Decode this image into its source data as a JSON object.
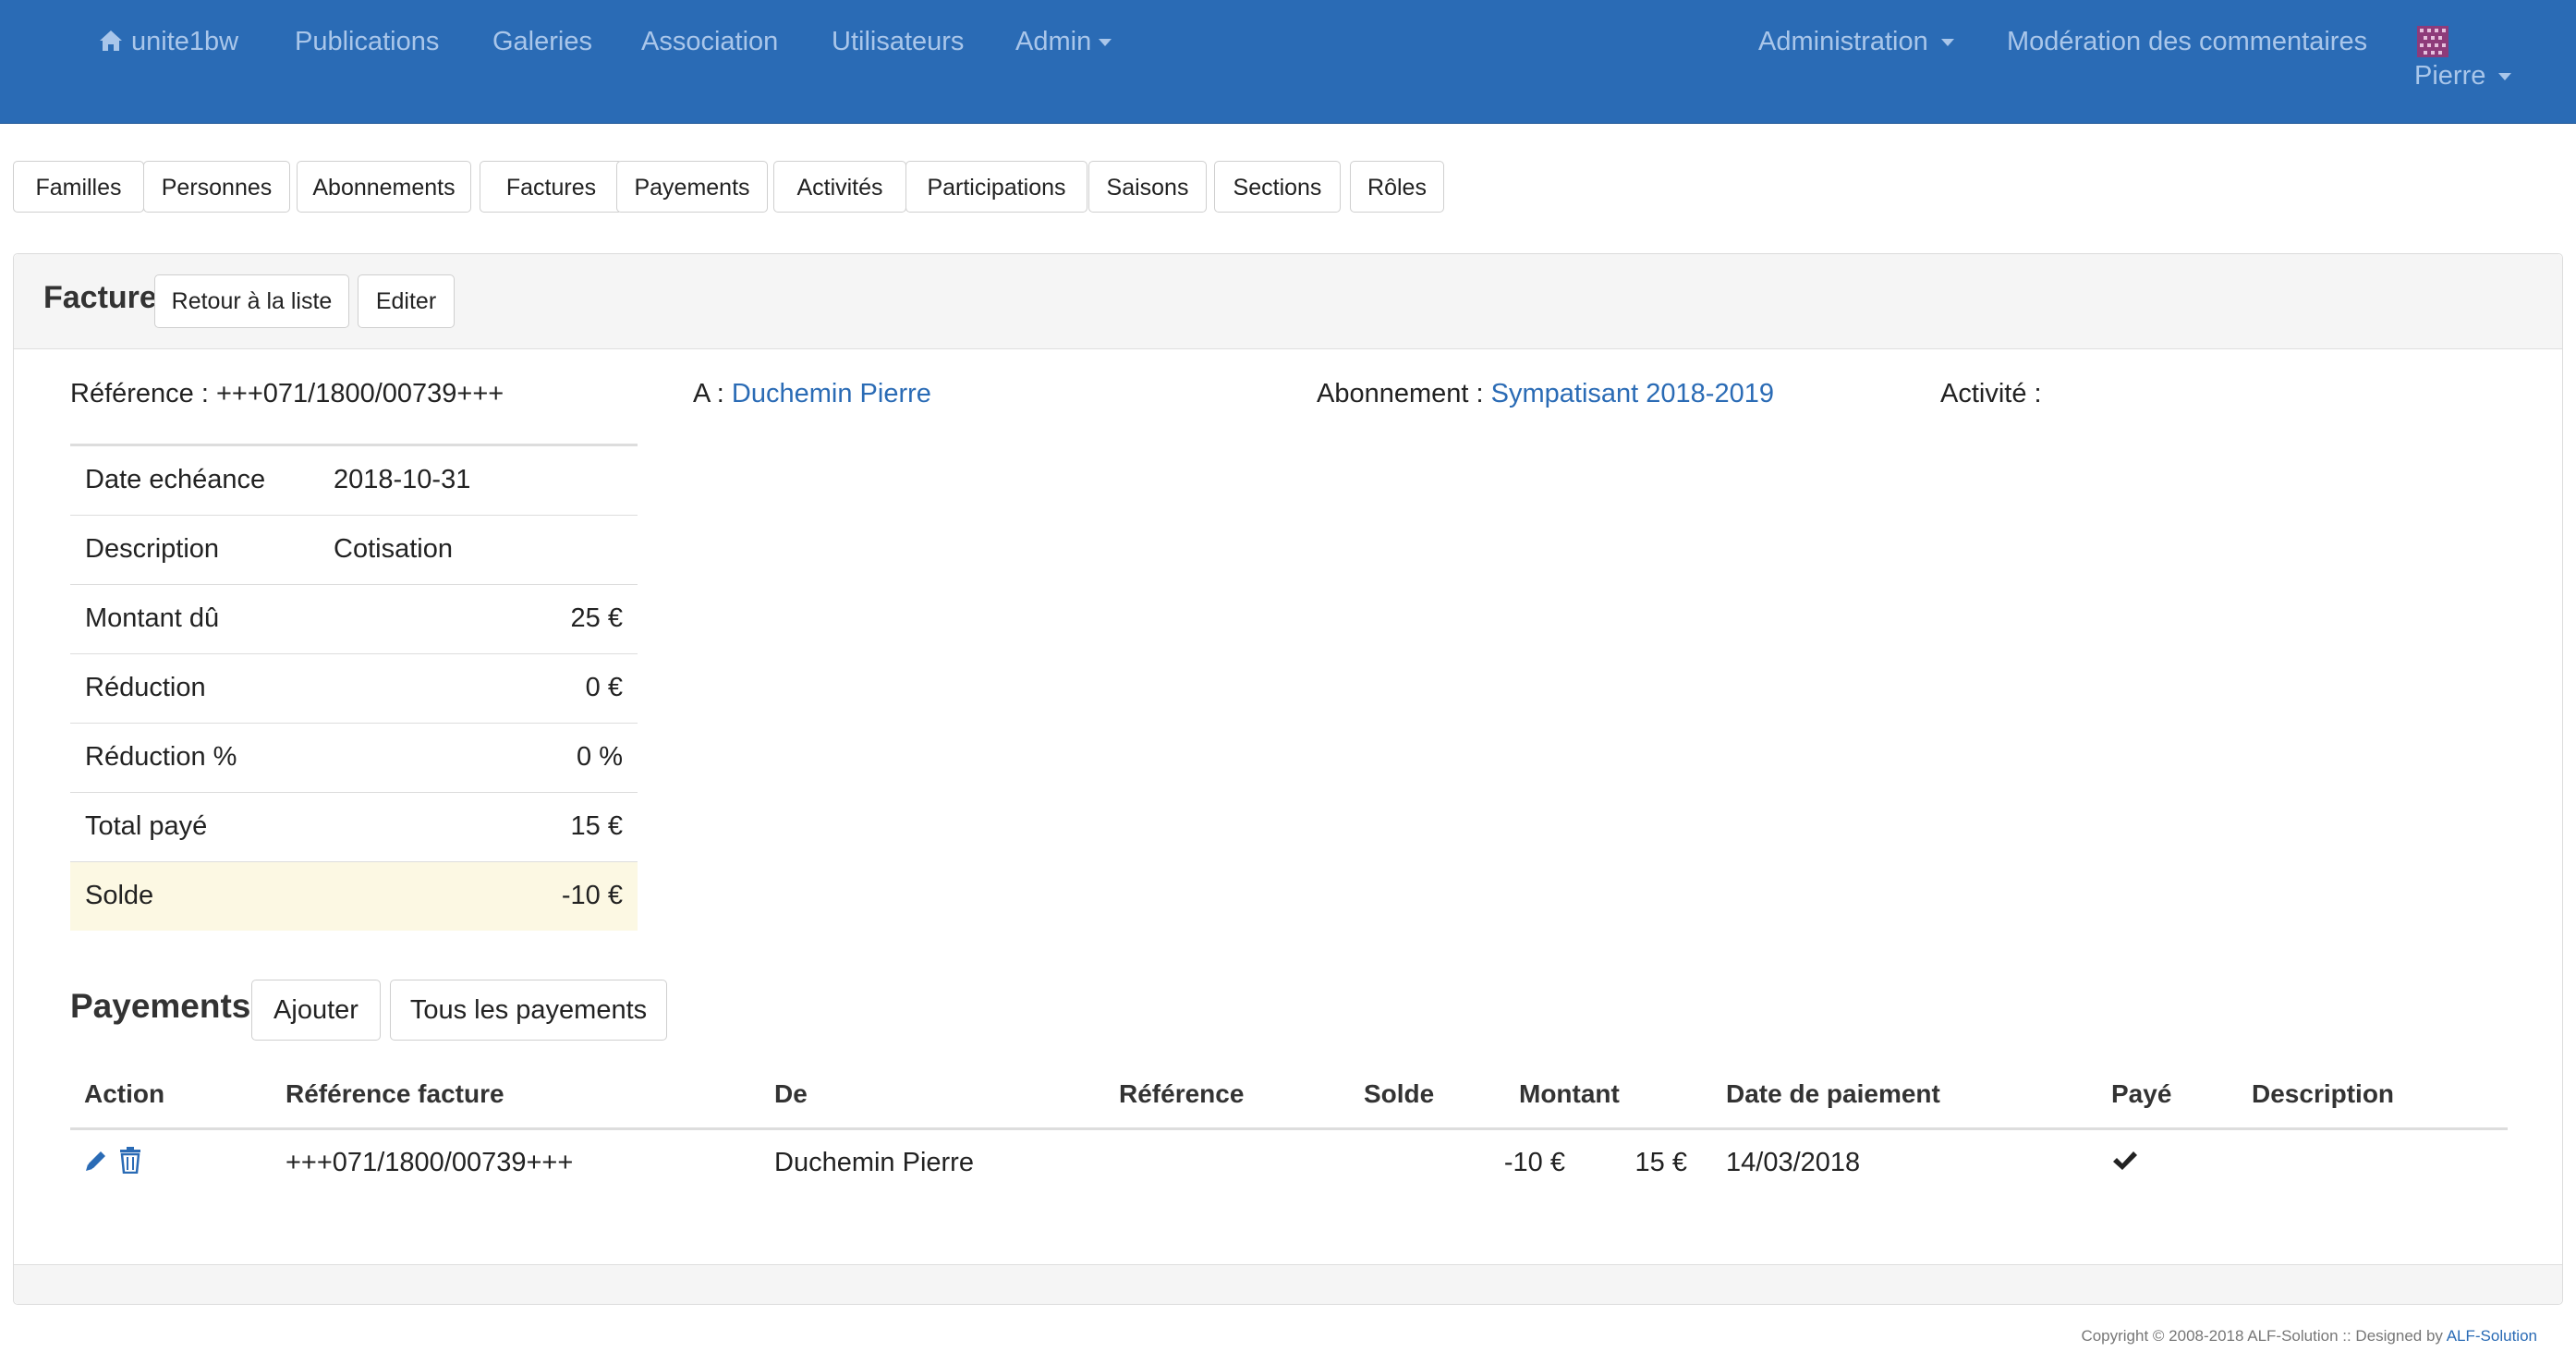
{
  "navbar": {
    "brand": "unite1bw",
    "items": [
      "Publications",
      "Galeries",
      "Association",
      "Utilisateurs",
      "Admin"
    ],
    "right_items": [
      "Administration",
      "Modération des commentaires"
    ],
    "user": "Pierre",
    "icons": [
      "home-icon",
      "avatar-icon",
      "caret-down-icon"
    ]
  },
  "tabs": [
    "Familles",
    "Personnes",
    "Abonnements",
    "Factures",
    "Payements",
    "Activités",
    "Participations",
    "Saisons",
    "Sections",
    "Rôles"
  ],
  "panel": {
    "title": "Facture",
    "back_button": "Retour à la liste",
    "edit_button": "Editer"
  },
  "summary": {
    "reference_label": "Référence : +++071/1800/00739+++",
    "to_label": "A :",
    "to_value": "Duchemin Pierre",
    "subscription_label": "Abonnement :",
    "subscription_value": "Sympatisant 2018-2019",
    "activity_label": "Activité :"
  },
  "details": [
    {
      "label": "Date echéance",
      "value": "2018-10-31"
    },
    {
      "label": "Description",
      "value": "Cotisation"
    },
    {
      "label": "Montant dû",
      "value": "25 €"
    },
    {
      "label": "Réduction",
      "value": "0 €"
    },
    {
      "label": "Réduction %",
      "value": "0 %"
    },
    {
      "label": "Total payé",
      "value": "15 €"
    },
    {
      "label": "Solde",
      "value": "-10 €"
    }
  ],
  "payments": {
    "title": "Payements",
    "add_button": "Ajouter",
    "all_button": "Tous les payements",
    "columns": [
      "Action",
      "Référence facture",
      "De",
      "Référence",
      "Solde",
      "Montant",
      "Date de paiement",
      "Payé",
      "Description"
    ],
    "rows": [
      {
        "reference_facture": "+++071/1800/00739+++",
        "de": "Duchemin Pierre",
        "reference": "",
        "solde": "-10 €",
        "montant": "15 €",
        "date": "14/03/2018",
        "paye_icon": "check-icon",
        "description": "",
        "action_icons": [
          "edit-icon",
          "trash-icon"
        ]
      }
    ]
  },
  "footer": {
    "text": "Copyright © 2008-2018 ALF-Solution :: Designed by ",
    "link": "ALF-Solution"
  },
  "colors": {
    "navbar_bg": "#2a6bb5",
    "nav_text": "#a9c6ea",
    "link": "#2a6bb5",
    "highlight_row": "#fcf8e3"
  }
}
